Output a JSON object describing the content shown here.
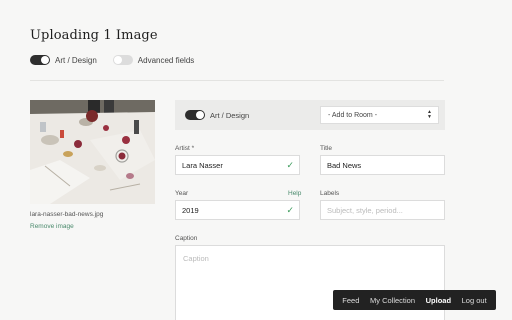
{
  "page": {
    "title": "Uploading 1 Image"
  },
  "top_toggles": [
    {
      "label": "Art / Design",
      "state": "on"
    },
    {
      "label": "Advanced fields",
      "state": "off"
    }
  ],
  "image": {
    "filename": "lara-nasser-bad-news.jpg",
    "remove_label": "Remove image"
  },
  "bar": {
    "toggle_label": "Art / Design",
    "room_select": "- Add to Room -"
  },
  "fields": {
    "artist": {
      "label": "Artist *",
      "value": "Lara Nasser"
    },
    "title": {
      "label": "Title",
      "value": "Bad News"
    },
    "year": {
      "label": "Year",
      "value": "2019",
      "help": "Help"
    },
    "labels": {
      "label": "Labels",
      "placeholder": "Subject, style, period..."
    },
    "caption": {
      "label": "Caption",
      "placeholder": "Caption"
    }
  },
  "nav": {
    "items": [
      {
        "label": "Feed"
      },
      {
        "label": "My Collection"
      },
      {
        "label": "Upload",
        "active": true
      },
      {
        "label": "Log out"
      }
    ]
  },
  "colors": {
    "accent_green": "#4a8a6c",
    "check_green": "#3a9a5a",
    "nav_bg": "#222222"
  }
}
